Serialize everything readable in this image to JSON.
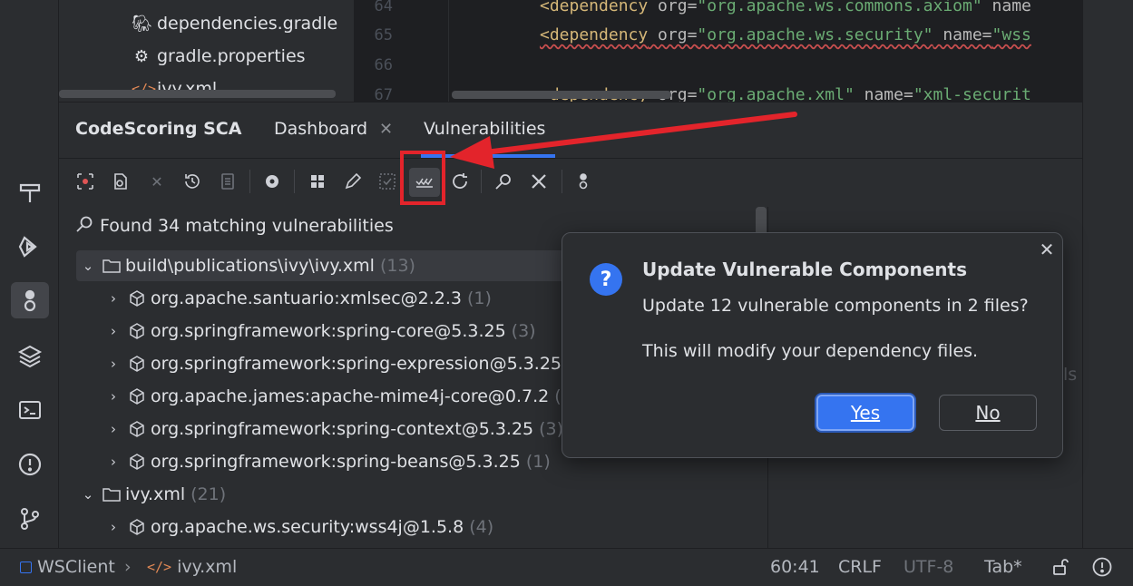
{
  "project_tree": {
    "files": [
      {
        "name": "dependencies.gradle",
        "icon": "gradle-icon"
      },
      {
        "name": "gradle.properties",
        "icon": "gear-icon"
      },
      {
        "name": "ivy.xml",
        "icon": "xml-icon"
      }
    ]
  },
  "editor": {
    "lines": [
      {
        "num": "64",
        "tag": "<dependency",
        "attr1": " org=",
        "val1": "\"org.apache.ws.commons.axiom\"",
        "attr2": " name",
        "val2": ""
      },
      {
        "num": "65",
        "tag": "<dependency",
        "attr1": " org=",
        "val1": "\"org.apache.ws.security\"",
        "attr2": " name=",
        "val2": "\"wss"
      },
      {
        "num": "66",
        "tag": "",
        "attr1": "",
        "val1": "",
        "attr2": "",
        "val2": ""
      },
      {
        "num": "67",
        "tag": "<dependency",
        "attr1": " org=",
        "val1": "\"org.apache.xml\"",
        "attr2": " name=",
        "val2": "\"xml-securit"
      }
    ]
  },
  "tool_window": {
    "title": "CodeScoring SCA",
    "tabs": [
      {
        "label": "Dashboard",
        "closable": true
      },
      {
        "label": "Vulnerabilities",
        "active": true
      }
    ],
    "found_text": "Found 34 matching vulnerabilities",
    "tree": [
      {
        "level": 0,
        "expanded": true,
        "label": "build\\publications\\ivy\\ivy.xml",
        "count": "(13)",
        "type": "folder"
      },
      {
        "level": 1,
        "label": "org.apache.santuario:xmlsec@2.2.3",
        "count": "(1)",
        "type": "package"
      },
      {
        "level": 1,
        "label": "org.springframework:spring-core@5.3.25",
        "count": "(3)",
        "type": "package"
      },
      {
        "level": 1,
        "label": "org.springframework:spring-expression@5.3.25",
        "count": "",
        "type": "package"
      },
      {
        "level": 1,
        "label": "org.apache.james:apache-mime4j-core@0.7.2",
        "count": "(1",
        "type": "package"
      },
      {
        "level": 1,
        "label": "org.springframework:spring-context@5.3.25",
        "count": "(3)",
        "type": "package"
      },
      {
        "level": 1,
        "label": "org.springframework:spring-beans@5.3.25",
        "count": "(1)",
        "type": "package"
      },
      {
        "level": 0,
        "expanded": true,
        "label": "ivy.xml",
        "count": "(21)",
        "type": "folder"
      },
      {
        "level": 1,
        "label": "org.apache.ws.security:wss4j@1.5.8",
        "count": "(4)",
        "type": "package"
      }
    ],
    "right_ghost": "ls"
  },
  "dialog": {
    "title": "Update Vulnerable Components",
    "message1": "Update 12 vulnerable components in 2 files?",
    "message2": "This will modify your dependency files.",
    "yes_label": "Yes",
    "no_label": "No"
  },
  "status_bar": {
    "project": "WSClient",
    "file": "ivy.xml",
    "position": "60:41",
    "line_sep": "CRLF",
    "encoding": "UTF-8",
    "indent": "Tab*"
  },
  "colors": {
    "accent": "#3574f0",
    "highlight_red": "#e3242b"
  }
}
